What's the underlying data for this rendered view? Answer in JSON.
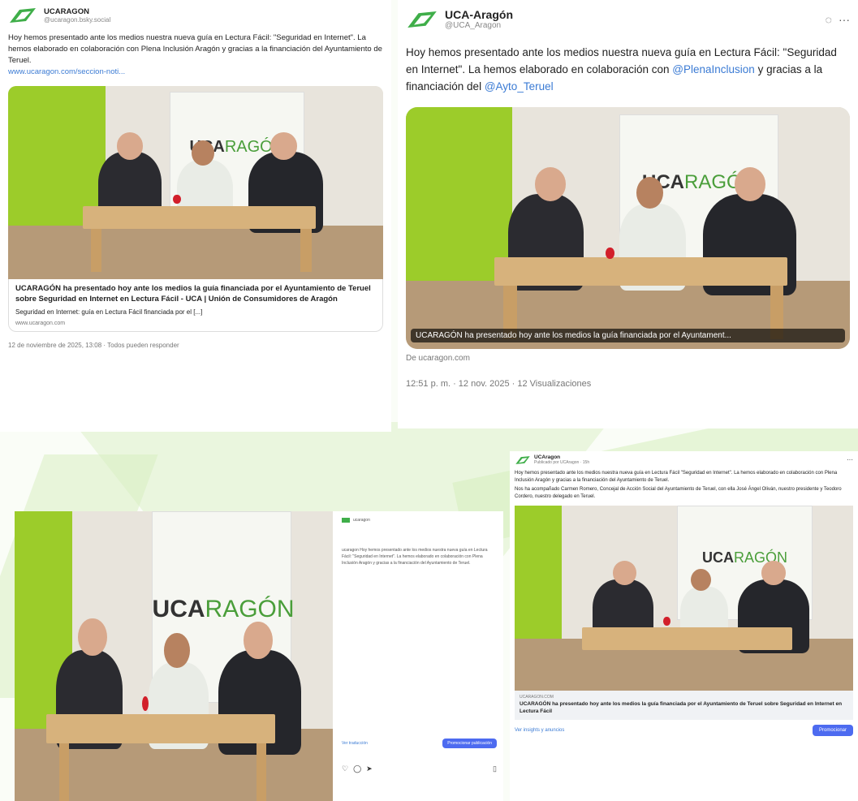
{
  "post1": {
    "name": "UCARAGON",
    "handle": "@ucaragon.bsky.social",
    "text": "Hoy hemos presentado ante los medios nuestra nueva guía en Lectura Fácil: \"Seguridad en Internet\". La hemos elaborado en colaboración con Plena Inclusión Aragón y gracias a la financiación del Ayuntamiento de Teruel.",
    "url": "www.ucaragon.com/seccion-noti...",
    "card_title": "UCARAGÓN ha presentado hoy ante los medios la guía financiada por el Ayuntamiento de Teruel sobre Seguridad en Internet en Lectura Fácil - UCA | Unión de Consumidores de Aragón",
    "card_desc": "Seguridad en Internet: guía en Lectura Fácil financiada por el [...]",
    "card_domain": "www.ucaragon.com",
    "footer": "12 de noviembre de 2025, 13:08 · Todos pueden responder"
  },
  "post2": {
    "name": "UCA-Aragón",
    "handle": "@UCA_Aragon",
    "text_a": "Hoy hemos presentado ante los medios nuestra nueva guía en Lectura Fácil: \"Seguridad en Internet\". La hemos elaborado en colaboración con",
    "mention1": "@PlenaInclusion",
    "text_b": "y gracias a la financiación del",
    "mention2": "@Ayto_Teruel",
    "caption": "UCARAGÓN ha presentado hoy ante los medios la guía financiada por el Ayuntament...",
    "source": "De ucaragon.com",
    "meta": "12:51 p. m. · 12 nov. 2025 · 12 Visualizaciones",
    "more_icon": "···"
  },
  "banner": {
    "uca": "UCA",
    "ragon": "RAGÓN"
  },
  "post3": {
    "account": "ucaragon",
    "caption": "ucaragon Hoy hemos presentado ante los medios nuestra nueva guía en Lectura Fácil: \"Seguridad en Internet\". La hemos elaborado en colaboración con Plena Inclusión Aragón y gracias a la financiación del Ayuntamiento de Teruel.",
    "translate": "Ver traducción",
    "promote": "Promocionar publicación"
  },
  "post4": {
    "name": "UCAragon",
    "subtitle": "Publicado por UCAragon · 15h",
    "text": "Hoy hemos presentado ante los medios nuestra nueva guía en Lectura Fácil \"Seguridad en Internet\". La hemos elaborado en colaboración con Plena Inclusión Aragón y gracias a la financiación del Ayuntamiento de Teruel.",
    "text2": "Nos ha acompañado Carmen Romero, Concejal de Acción Social del Ayuntamiento de Teruel, con ella José Ángel Oliván, nuestro presidente y Teodoro Cordero, nuestro delegado en Teruel.",
    "link_domain": "UCARAGON.COM",
    "link_title": "UCARAGÓN ha presentado hoy ante los medios la guía financiada por el Ayuntamiento de Teruel sobre Seguridad en Internet en Lectura Fácil",
    "insights": "Ver insights y anuncios",
    "promote": "Promocionar"
  },
  "colors": {
    "brand_green": "#3fae49",
    "link_blue": "#3b7bd4",
    "promote_blue": "#4d6bf0"
  }
}
